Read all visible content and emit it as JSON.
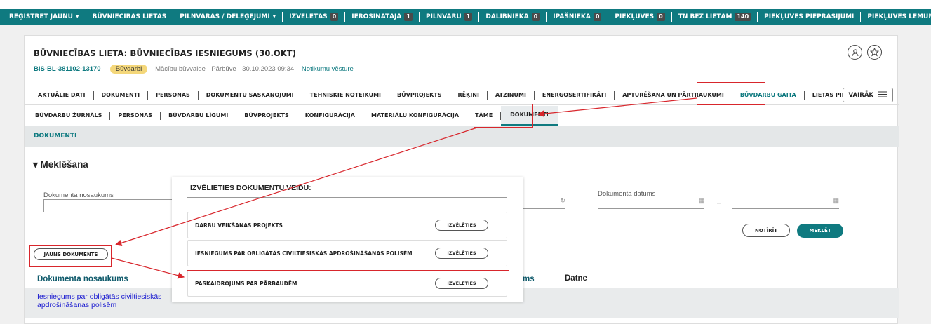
{
  "topnav": {
    "items": [
      {
        "label": "REĢISTRĒT JAUNU",
        "caret": "▾",
        "count": ""
      },
      {
        "label": "BŪVNIECĪBAS LIETAS",
        "caret": "",
        "count": ""
      },
      {
        "label": "PILNVARAS / DELEĢĒJUMI",
        "caret": "▾",
        "count": ""
      },
      {
        "label": "IZVĒLĒTĀS",
        "caret": "",
        "count": "0"
      },
      {
        "label": "IEROSINĀTĀJA",
        "caret": "",
        "count": "1"
      },
      {
        "label": "PILNVARU",
        "caret": "",
        "count": "1"
      },
      {
        "label": "DALĪBNIEKA",
        "caret": "",
        "count": "0"
      },
      {
        "label": "ĪPAŠNIEKA",
        "caret": "",
        "count": "0"
      },
      {
        "label": "PIEKĻUVES",
        "caret": "",
        "count": "0"
      },
      {
        "label": "TN BEZ LIETĀM",
        "caret": "",
        "count": "140"
      },
      {
        "label": "PIEKĻUVES PIEPRASĪJUMI",
        "caret": "",
        "count": ""
      },
      {
        "label": "PIEKĻUVES LĒMUMI",
        "caret": "",
        "count": ""
      }
    ]
  },
  "header": {
    "title": "BŪVNIECĪBAS LIETA: BŪVNIECĪBAS IESNIEGUMS (30.OKT)",
    "case_id": "BIS-BL-381102-13170",
    "status": "Būvdarbi",
    "meta_text": "· Mācību būvvalde · Pārbūve · 30.10.2023 09:34 ·",
    "history_link": "Notikumu vēsture",
    "person_icon": "user-icon",
    "star_icon": "star-icon"
  },
  "tabs1": {
    "items": [
      "AKTUĀLIE DATI",
      "DOKUMENTI",
      "PERSONAS",
      "DOKUMENTU SASKAŅOJUMI",
      "TEHNISKIE NOTEIKUMI",
      "BŪVPROJEKTS",
      "RĒĶINI",
      "ATZINUMI",
      "ENERGOSERTIFIKĀTI",
      "APTURĒŠANA UN PĀRTRAUKUMI",
      "BŪVDARBU GAITA",
      "LIETAS PILNVARAS/DEI"
    ],
    "active_index": 10,
    "more_label": "VAIRĀK"
  },
  "tabs2": {
    "items": [
      "BŪVDARBU ŽURNĀLS",
      "PERSONAS",
      "BŪVDARBU LĪGUMI",
      "BŪVPROJEKTS",
      "KONFIGURĀCIJA",
      "MATERIĀLU KONFIGURĀCIJA",
      "TĀME",
      "DOKUMENTI"
    ],
    "active_index": 7
  },
  "section_title": "DOKUMENTI",
  "search": {
    "heading": "▾ Meklēšana",
    "doc_name_label": "Dokumenta nosaukums",
    "doc_date_label": "Dokumenta datums",
    "date_dash": "–",
    "calendar_glyph": "▦",
    "refresh_glyph": "↻",
    "clear_label": "NOTĪRĪT",
    "search_label": "MEKLĒT",
    "new_doc_label": "JAUNS DOKUMENTS"
  },
  "table": {
    "col_name": "Dokumenta nosaukums",
    "col_partial": "ums",
    "col_file": "Datne",
    "rows": [
      {
        "name_line1": "Iesniegums par obligātās civiltiesiskās",
        "name_line2": "apdrošināšanas polisēm"
      }
    ]
  },
  "popup": {
    "title": "IZVĒLIETIES DOKUMENTU VEIDU:",
    "select_label": "IZVĒLĒTIES",
    "options": [
      "DARBU VEIKŠANAS PROJEKTS",
      "IESNIEGUMS PAR OBLIGĀTĀS CIVILTIESISKĀS APDROŠINĀŠANAS POLISĒM",
      "PASKAIDROJUMS PAR PĀRBAUDĒM"
    ]
  },
  "colors": {
    "accent": "#0f7a80",
    "highlight": "#d8262c",
    "badge": "#f4d77a"
  }
}
